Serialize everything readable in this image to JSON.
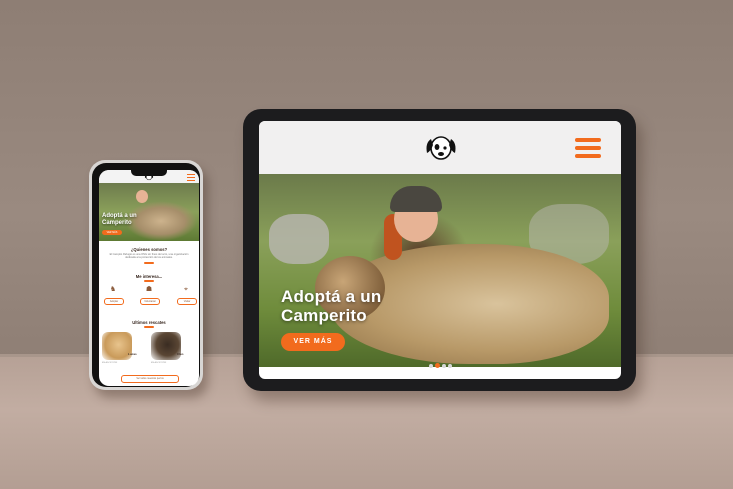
{
  "scene": {
    "wall_color": "#8e7e74",
    "shelf_color": "#c2ada2",
    "accent": "#f26b1d"
  },
  "tablet": {
    "logo_icon": "dog-face-icon",
    "menu_icon": "hamburger-menu-icon",
    "hero": {
      "title": "Adoptá a un Camperito",
      "button_label": "VER MÁS",
      "carousel_dots": 4,
      "active_dot": 2
    }
  },
  "phone": {
    "logo_icon": "dog-face-icon",
    "menu_icon": "hamburger-menu-icon",
    "hero": {
      "title": "Adoptá a un Camperito",
      "button_label": "VER MÁS"
    },
    "about": {
      "title": "¿Quienes somos?",
      "text": "El Campito Refugio es una ONG sin fines de lucro, una organización dedicada a la protección de los animales."
    },
    "interests": {
      "title": "Me interesa...",
      "items": [
        {
          "icon": "adopt-icon",
          "label": "Adoptar"
        },
        {
          "icon": "volunteer-icon",
          "label": "Voluntariar"
        },
        {
          "icon": "visit-icon",
          "label": "Visitar"
        }
      ]
    },
    "rescues": {
      "title": "Ultimos rescates",
      "items": [
        {
          "name": "Lucas",
          "status": "EN ADOPCIÓN"
        },
        {
          "name": "Cleo",
          "status": "EN ADOPCIÓN"
        }
      ],
      "more_label": "Ver todos nuestros perros"
    }
  }
}
